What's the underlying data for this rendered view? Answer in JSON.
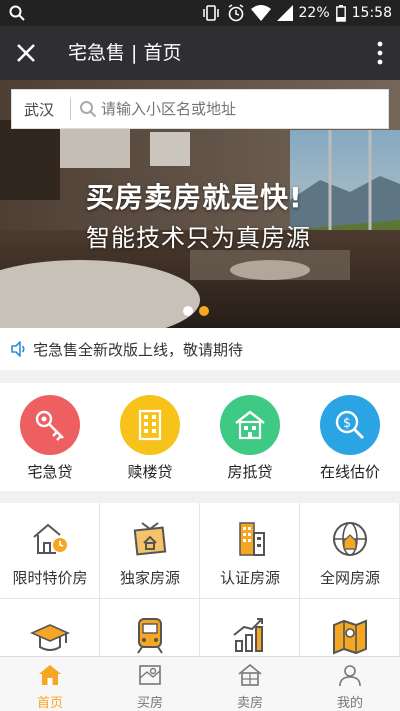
{
  "status_bar": {
    "battery": "22%",
    "time": "15:58"
  },
  "header": {
    "title": "宅急售 | 首页"
  },
  "search": {
    "city": "武汉",
    "placeholder": "请输入小区名或地址"
  },
  "banner": {
    "slogan_main": "买房卖房就是快!",
    "slogan_sub": "智能技术只为真房源"
  },
  "notice": {
    "text": "宅急售全新改版上线，敬请期待"
  },
  "loans": [
    {
      "label": "宅急贷",
      "icon": "key-icon",
      "color": "#ee5f62"
    },
    {
      "label": "赎楼贷",
      "icon": "building-icon",
      "color": "#f7c31a"
    },
    {
      "label": "房抵贷",
      "icon": "house-icon",
      "color": "#3ec985"
    },
    {
      "label": "在线估价",
      "icon": "price-search-icon",
      "color": "#2aa4e2"
    }
  ],
  "grid_items": [
    {
      "label": "限时特价房",
      "icon": "house-clock-icon"
    },
    {
      "label": "独家房源",
      "icon": "house-sign-icon"
    },
    {
      "label": "认证房源",
      "icon": "building-certified-icon"
    },
    {
      "label": "全网房源",
      "icon": "globe-house-icon"
    },
    {
      "label": "",
      "icon": "graduation-cap-icon"
    },
    {
      "label": "",
      "icon": "metro-train-icon"
    },
    {
      "label": "",
      "icon": "rising-bars-icon"
    },
    {
      "label": "",
      "icon": "map-pin-icon"
    }
  ],
  "tabs": [
    {
      "label": "首页",
      "icon": "home-icon",
      "active": true
    },
    {
      "label": "买房",
      "icon": "map-icon",
      "active": false
    },
    {
      "label": "卖房",
      "icon": "house-outline-icon",
      "active": false
    },
    {
      "label": "我的",
      "icon": "user-icon",
      "active": false
    }
  ],
  "colors": {
    "accent": "#f5a623",
    "title_bar": "#2e2e33",
    "status_bar": "#222222"
  }
}
